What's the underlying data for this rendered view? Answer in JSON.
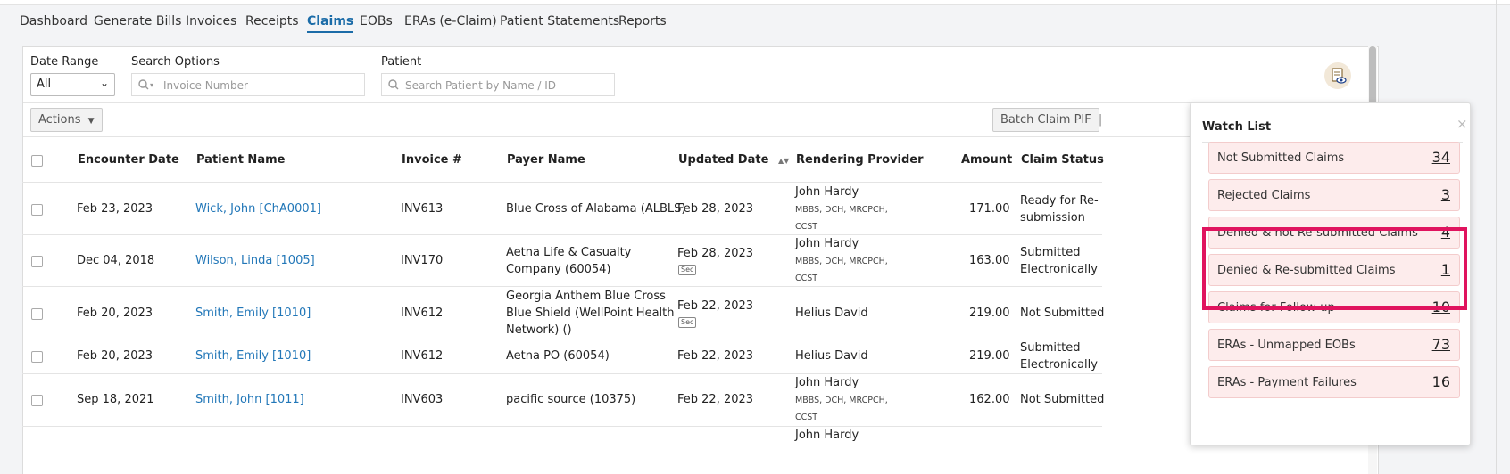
{
  "nav": {
    "tabs": [
      "Dashboard",
      "Generate Bills",
      "Invoices",
      "Receipts",
      "Claims",
      "EOBs",
      "ERAs (e-Claim)",
      "Patient Statements",
      "Reports"
    ],
    "active": "Claims"
  },
  "filters": {
    "date_range_label": "Date Range",
    "date_range_value": "All",
    "search_options_label": "Search Options",
    "search_placeholder": "Invoice Number",
    "patient_label": "Patient",
    "patient_placeholder": "Search Patient by Name / ID"
  },
  "toolbar": {
    "actions_label": "Actions",
    "batch_label": "Batch Claim PIF"
  },
  "table": {
    "headers": [
      "Encounter Date",
      "Patient Name",
      "Invoice #",
      "Payer Name",
      "Updated Date",
      "Rendering Provider",
      "Amount",
      "Claim Status"
    ],
    "rows": [
      {
        "encounter": "Feb 23, 2023",
        "patient": "Wick, John [ChA0001]",
        "invoice": "INV613",
        "payer": [
          "Blue Cross of Alabama (ALBLS)"
        ],
        "updated": "Feb 28, 2023",
        "sec": "",
        "provider": "John Hardy",
        "credentials": [
          "MBBS, DCH, MRCPCH,",
          "CCST"
        ],
        "amount": "171.00",
        "status": [
          "Ready for Re-",
          "submission"
        ]
      },
      {
        "encounter": "Dec 04, 2018",
        "patient": "Wilson, Linda [1005]",
        "invoice": "INV170",
        "payer": [
          "Aetna Life & Casualty",
          "Company (60054)"
        ],
        "updated": "Feb 28, 2023",
        "sec": "Sec",
        "provider": "John Hardy",
        "credentials": [
          "MBBS, DCH, MRCPCH,",
          "CCST"
        ],
        "amount": "163.00",
        "status": [
          "Submitted",
          "Electronically"
        ]
      },
      {
        "encounter": "Feb 20, 2023",
        "patient": "Smith, Emily [1010]",
        "invoice": "INV612",
        "payer": [
          "Georgia Anthem Blue Cross",
          "Blue Shield (WellPoint Health",
          "Network) ()"
        ],
        "updated": "Feb 22, 2023",
        "sec": "Sec",
        "provider": "Helius David",
        "credentials": [],
        "amount": "219.00",
        "status": [
          "Not Submitted"
        ]
      },
      {
        "encounter": "Feb 20, 2023",
        "patient": "Smith, Emily [1010]",
        "invoice": "INV612",
        "payer": [
          "Aetna PO (60054)"
        ],
        "updated": "Feb 22, 2023",
        "sec": "",
        "provider": "Helius David",
        "credentials": [],
        "amount": "219.00",
        "status": [
          "Submitted",
          "Electronically"
        ]
      },
      {
        "encounter": "Sep 18, 2021",
        "patient": "Smith, John [1011]",
        "invoice": "INV603",
        "payer": [
          "pacific source (10375)"
        ],
        "updated": "Feb 22, 2023",
        "sec": "",
        "provider": "John Hardy",
        "credentials": [
          "MBBS, DCH, MRCPCH,",
          "CCST"
        ],
        "amount": "162.00",
        "status": [
          "Not Submitted"
        ]
      }
    ],
    "partial_provider": "John Hardy"
  },
  "watchlist": {
    "title": "Watch List",
    "close": "×",
    "items": [
      {
        "label": "Not Submitted Claims",
        "count": "34"
      },
      {
        "label": "Rejected Claims",
        "count": "3"
      },
      {
        "label": "Denied & not Re-submitted Claims",
        "count": "4"
      },
      {
        "label": "Denied & Re-submitted Claims",
        "count": "1"
      },
      {
        "label": "Claims for Follow-up",
        "count": "10"
      },
      {
        "label": "ERAs - Unmapped EOBs",
        "count": "73"
      },
      {
        "label": "ERAs - Payment Failures",
        "count": "16"
      }
    ]
  },
  "colors": {
    "accent": "#1b6ca8",
    "highlight": "#e0135e",
    "watch_item_bg": "#fdecec"
  },
  "icons": {
    "search": "search-icon",
    "watch": "watchlist-eye-icon",
    "sort": "sort-icon",
    "chevron": "chevron-down-icon"
  }
}
